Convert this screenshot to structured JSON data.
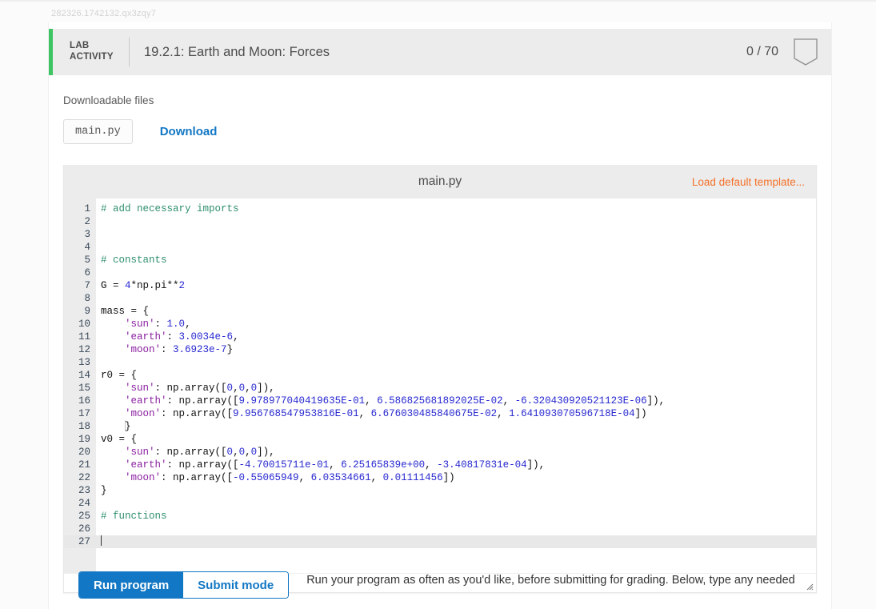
{
  "session_id": "282326.1742132.qx3zqy7",
  "header": {
    "kicker_line1": "LAB",
    "kicker_line2": "ACTIVITY",
    "title": "19.2.1: Earth and Moon: Forces",
    "score": "0 / 70",
    "accent_color": "#3dc463",
    "shield_icon": "shield-outline-icon"
  },
  "downloads": {
    "label": "Downloadable files",
    "file_name": "main.py",
    "download_label": "Download",
    "link_color": "#1277c4"
  },
  "editor": {
    "filename": "main.py",
    "template_link": "Load default template...",
    "template_link_color": "#f4712a",
    "active_line": 27,
    "total_lines": 27,
    "lines": [
      {
        "n": "1",
        "text": "# add necessary imports",
        "kind": "comment"
      },
      {
        "n": "2",
        "text": "",
        "kind": "blank"
      },
      {
        "n": "3",
        "text": "",
        "kind": "blank"
      },
      {
        "n": "4",
        "text": "",
        "kind": "blank"
      },
      {
        "n": "5",
        "text": "# constants",
        "kind": "comment"
      },
      {
        "n": "6",
        "text": "",
        "kind": "blank"
      },
      {
        "n": "7",
        "text": "G = 4*np.pi**2",
        "kind": "code"
      },
      {
        "n": "8",
        "text": "",
        "kind": "blank"
      },
      {
        "n": "9",
        "text": "mass = {",
        "kind": "code"
      },
      {
        "n": "10",
        "text": "    'sun': 1.0,",
        "kind": "code"
      },
      {
        "n": "11",
        "text": "    'earth': 3.0034e-6,",
        "kind": "code"
      },
      {
        "n": "12",
        "text": "    'moon': 3.6923e-7}",
        "kind": "code"
      },
      {
        "n": "13",
        "text": "",
        "kind": "blank"
      },
      {
        "n": "14",
        "text": "r0 = {",
        "kind": "code"
      },
      {
        "n": "15",
        "text": "    'sun': np.array([0,0,0]),",
        "kind": "code"
      },
      {
        "n": "16",
        "text": "    'earth': np.array([9.978977040419635E-01, 6.586825681892025E-02, -6.320430920521123E-06]),",
        "kind": "code"
      },
      {
        "n": "17",
        "text": "    'moon': np.array([9.956768547953816E-01, 6.676030485840675E-02, 1.641093070596718E-04])",
        "kind": "code"
      },
      {
        "n": "18",
        "text": "    }",
        "kind": "code-guide"
      },
      {
        "n": "19",
        "text": "v0 = {",
        "kind": "code"
      },
      {
        "n": "20",
        "text": "    'sun': np.array([0,0,0]),",
        "kind": "code"
      },
      {
        "n": "21",
        "text": "    'earth': np.array([-4.70015711e-01, 6.25165839e+00, -3.40817831e-04]),",
        "kind": "code"
      },
      {
        "n": "22",
        "text": "    'moon': np.array([-0.55065949, 6.03534661, 0.01111456])",
        "kind": "code"
      },
      {
        "n": "23",
        "text": "}",
        "kind": "code"
      },
      {
        "n": "24",
        "text": "",
        "kind": "blank"
      },
      {
        "n": "25",
        "text": "# functions",
        "kind": "comment"
      },
      {
        "n": "26",
        "text": "",
        "kind": "blank"
      },
      {
        "n": "27",
        "text": "",
        "kind": "caret"
      }
    ],
    "resize_grip_icon": "resize-grip-icon"
  },
  "actions": {
    "run_label": "Run program",
    "submit_label": "Submit mode",
    "note": "Run your program as often as you'd like, before submitting for grading. Below, type any needed"
  }
}
